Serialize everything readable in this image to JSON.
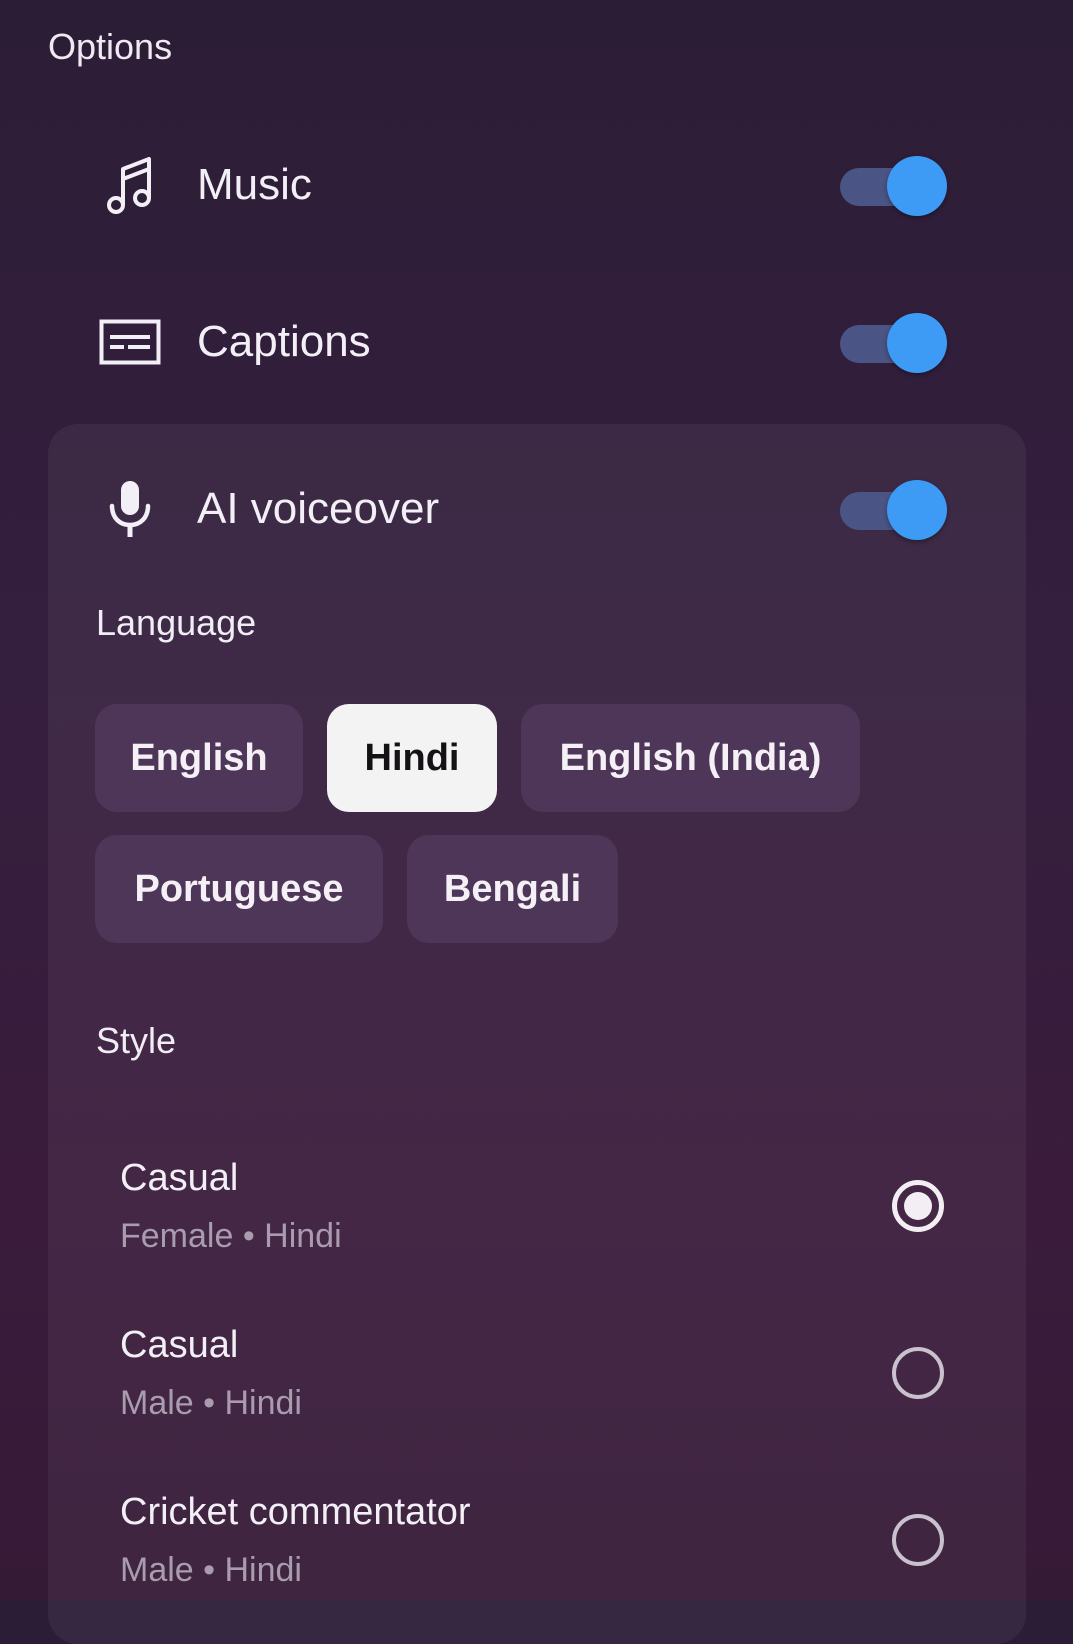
{
  "header": {
    "title": "Options"
  },
  "options": {
    "music": {
      "label": "Music",
      "icon": "music-note-icon",
      "enabled": true
    },
    "captions": {
      "label": "Captions",
      "icon": "captions-icon",
      "enabled": true
    },
    "voiceover": {
      "label": "AI voiceover",
      "icon": "microphone-icon",
      "enabled": true
    }
  },
  "language": {
    "title": "Language",
    "selected": "Hindi",
    "options": [
      "English",
      "Hindi",
      "English (India)",
      "Portuguese",
      "Bengali"
    ]
  },
  "style": {
    "title": "Style",
    "items": [
      {
        "name": "Casual",
        "meta": "Female • Hindi",
        "selected": true
      },
      {
        "name": "Casual",
        "meta": "Male • Hindi",
        "selected": false
      },
      {
        "name": "Cricket commentator",
        "meta": "Male • Hindi",
        "selected": false
      }
    ]
  },
  "colors": {
    "toggle_knob": "#3d9bf6",
    "toggle_track": "#4a5485",
    "chip_bg": "#4e3659",
    "chip_selected_bg": "#f4f3f4"
  }
}
